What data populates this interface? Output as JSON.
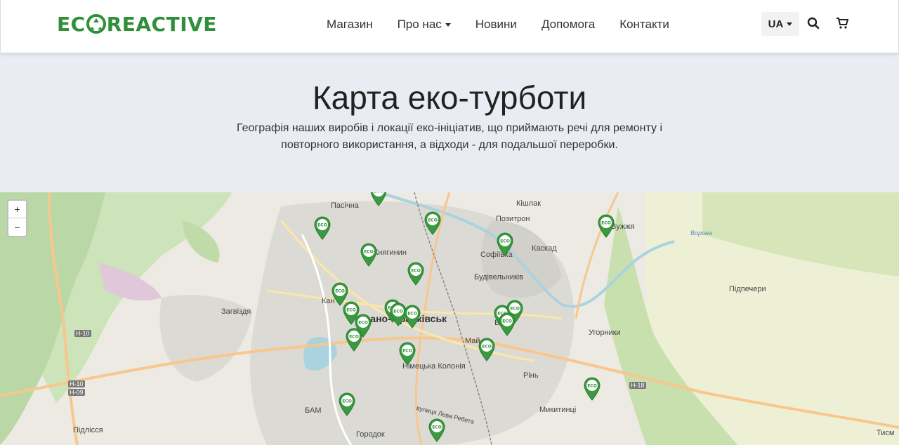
{
  "header": {
    "logo_text": "ECOREACTIVE",
    "brand_color": "#2f8f3a",
    "nav": [
      {
        "label": "Магазин",
        "dropdown": false
      },
      {
        "label": "Про нас",
        "dropdown": true
      },
      {
        "label": "Новини",
        "dropdown": false
      },
      {
        "label": "Допомога",
        "dropdown": false
      },
      {
        "label": "Контакти",
        "dropdown": false
      }
    ],
    "language": "UA",
    "icons": [
      "search-icon",
      "cart-icon"
    ]
  },
  "hero": {
    "title": "Карта еко-турботи",
    "subtitle": "Географія наших виробів і локації еко-ініціатив, що приймають речі для ремонту і повторного використання, а відходи - для подальшої переробки."
  },
  "map": {
    "zoom_in": "+",
    "zoom_out": "−",
    "marker_text": "ECO",
    "places": {
      "pasichna": "Пасічна",
      "knyahynyn": "Княгинин",
      "kishlak": "Кішлак",
      "pozytron": "Позитрон",
      "kaskad": "Каскад",
      "sofiivka": "Софіївка",
      "budivelnykiv": "Будівельників",
      "uzhzhya": "Вужжя",
      "pidpechery": "Підпечери",
      "zahvizdya": "Загвіздя",
      "kaniv": "Кан",
      "city": "Івано-Франківськ",
      "mai": "Май",
      "b": "Б",
      "uhornyky": "Угорники",
      "nimetska": "Німецька Колонія",
      "rin": "Рінь",
      "mykytyntsi": "Микитинці",
      "bam": "БАМ",
      "horodok": "Городок",
      "pidlissya": "Підлісся",
      "tysm": "Тисм",
      "levarebeta": "вулиця Лева Ребета",
      "vorona": "Ворона"
    },
    "roads": {
      "h10": "Н-10",
      "h10b": "Н-10",
      "h09": "Н-09",
      "h18": "Н-18"
    }
  }
}
